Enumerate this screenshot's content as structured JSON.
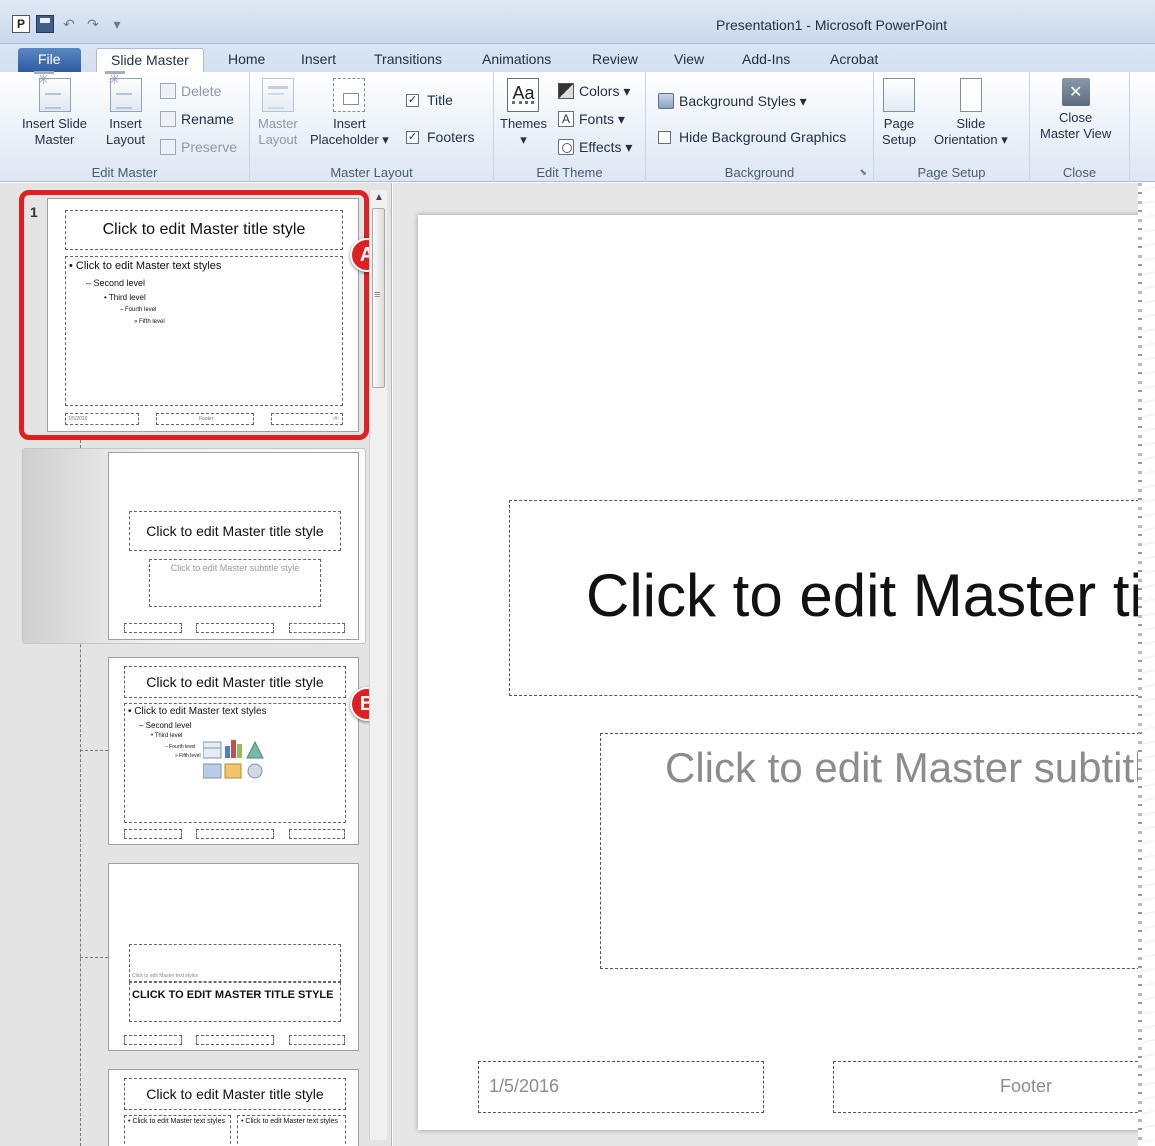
{
  "window": {
    "title": "Presentation1 - Microsoft PowerPoint"
  },
  "qat": {
    "app_glyph": "P",
    "undo_glyph": "↶",
    "redo_glyph": "↷",
    "more_glyph": "▾"
  },
  "tabs": [
    "File",
    "Slide Master",
    "Home",
    "Insert",
    "Transitions",
    "Animations",
    "Review",
    "View",
    "Add-Ins",
    "Acrobat"
  ],
  "ribbon": {
    "edit_master": {
      "label": "Edit Master",
      "insert_slide_master": [
        "Insert Slide",
        "Master"
      ],
      "insert_layout": [
        "Insert",
        "Layout"
      ],
      "delete": "Delete",
      "rename": "Rename",
      "preserve": "Preserve"
    },
    "master_layout": {
      "label": "Master Layout",
      "master_layout_btn": [
        "Master",
        "Layout"
      ],
      "insert_placeholder": [
        "Insert",
        "Placeholder ▾"
      ],
      "title_chk": "Title",
      "footers_chk": "Footers"
    },
    "edit_theme": {
      "label": "Edit Theme",
      "themes": "Themes",
      "themes_arrow": "▾",
      "themes_glyph": "Aa",
      "colors": "Colors ▾",
      "fonts": "Fonts ▾",
      "fonts_glyph": "A",
      "effects": "Effects ▾"
    },
    "background": {
      "label": "Background",
      "bg_styles": "Background Styles ▾",
      "hide_bg": "Hide Background Graphics",
      "launcher": "⬊"
    },
    "page_setup": {
      "label": "Page Setup",
      "page_setup_btn": [
        "Page",
        "Setup"
      ],
      "orientation": [
        "Slide",
        "Orientation ▾"
      ]
    },
    "close": {
      "label": "Close",
      "close_btn": [
        "Close",
        "Master View"
      ],
      "close_glyph": "✕"
    }
  },
  "pane": {
    "slide_number": "1",
    "callout_a": "A",
    "callout_b": "B",
    "scroll_up": "▲",
    "thumbs": {
      "master": {
        "title": "Click to edit Master title style",
        "levels": [
          "Click to edit Master text styles",
          "Second level",
          "Third level",
          "Fourth level",
          "Fifth level"
        ],
        "footer_date": "1/5/2016",
        "footer_center": "Footer",
        "footer_num": "‹#›"
      },
      "layout1": {
        "title": "Click to edit Master title style",
        "subtitle": "Click to edit Master subtitle style"
      },
      "layout2": {
        "title": "Click to edit Master title style",
        "levels": [
          "Click to edit Master text styles",
          "Second level",
          "Third level",
          "Fourth level",
          "Fifth level"
        ]
      },
      "layout3": {
        "small_text": "Click to edit Master text styles",
        "title": "CLICK TO EDIT MASTER TITLE STYLE"
      },
      "layout4": {
        "title": "Click to edit Master title style",
        "col_left": "Click to edit Master text styles",
        "col_right": "Click to edit Master text styles"
      }
    }
  },
  "slide": {
    "title": "Click to edit Master title style",
    "subtitle": "Click to edit Master subtitle style",
    "footer_date": "1/5/2016",
    "footer_center": "Footer"
  }
}
